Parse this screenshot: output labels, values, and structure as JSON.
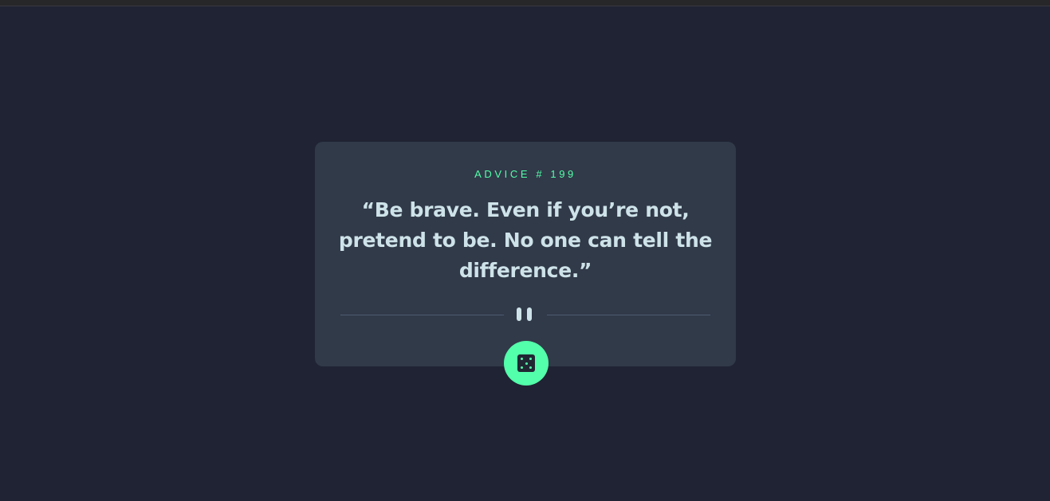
{
  "advice": {
    "id_label": "ADVICE # 199",
    "quote": "“Be brave. Even if you’re not, pretend to be. No one can tell the difference.”"
  },
  "divider": {
    "icon": "pause-icon"
  },
  "dice_button": {
    "icon": "dice-icon"
  },
  "colors": {
    "background": "#202333",
    "card": "#313a49",
    "accent": "#52ffa8",
    "text": "#cee3e9",
    "divider": "#4e5d73"
  }
}
